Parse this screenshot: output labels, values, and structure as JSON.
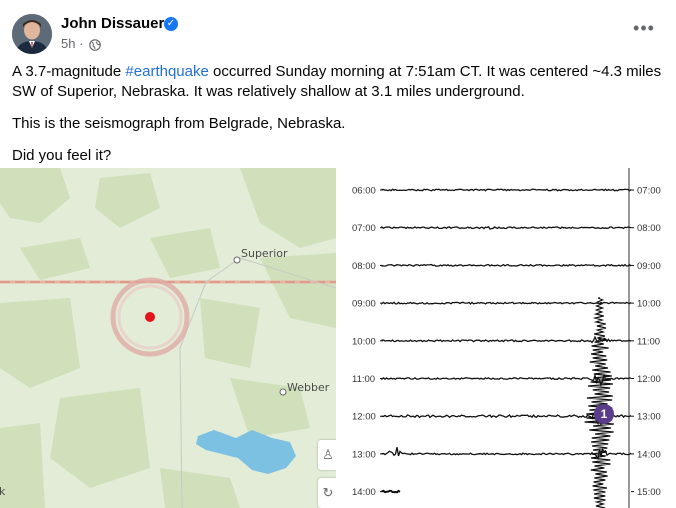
{
  "post": {
    "author": "John Dissauer",
    "time": "5h",
    "visibility_icon": "globe-icon",
    "more_icon": "more-options-icon",
    "paragraphs": {
      "p1_pre": "A 3.7-magnitude ",
      "p1_tag": "#earthquake",
      "p1_post": " occurred Sunday morning at 7:51am CT. It was centered ~4.3 miles SW of Superior, Nebraska. It was relatively shallow at 3.1 miles underground.",
      "p2": "This is the seismograph from Belgrade, Nebraska.",
      "p3": "Did you feel it?"
    },
    "accent_color": "#1877f2"
  },
  "map": {
    "places": [
      "Superior",
      "Webber"
    ],
    "epicenter_color": "#e3141b",
    "corner_text": "k"
  },
  "seismograph": {
    "left_times": [
      "06:00",
      "07:00",
      "08:00",
      "09:00",
      "10:00",
      "11:00",
      "12:00",
      "13:00",
      "14:00"
    ],
    "right_times": [
      "07:00",
      "08:00",
      "09:00",
      "10:00",
      "11:00",
      "12:00",
      "13:00",
      "14:00",
      "15:00"
    ],
    "event_marker": "1",
    "marker_color": "#5b3c8a"
  }
}
